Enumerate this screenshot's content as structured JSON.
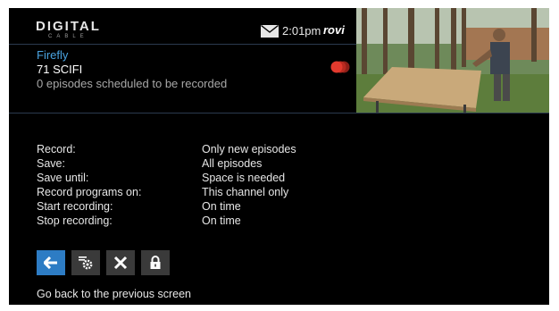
{
  "header": {
    "brand_name": "DIGITAL",
    "brand_sub": "CABLE",
    "time": "2:01pm",
    "provider_logo": "rovi"
  },
  "program": {
    "title": "Firefly",
    "channel": "71 SCIFI",
    "scheduled": "0 episodes scheduled to be recorded"
  },
  "settings": [
    {
      "label": "Record:",
      "value": "Only new episodes"
    },
    {
      "label": "Save:",
      "value": "All episodes"
    },
    {
      "label": "Save until:",
      "value": "Space is needed"
    },
    {
      "label": "Record programs on:",
      "value": "This channel only"
    },
    {
      "label": "Start recording:",
      "value": "On time"
    },
    {
      "label": "Stop recording:",
      "value": "On time"
    }
  ],
  "actions": {
    "icons": [
      "back-arrow-icon",
      "gear-icon",
      "close-icon",
      "lock-icon"
    ]
  },
  "hint": "Go back to the previous screen",
  "colors": {
    "background": "#000000",
    "title": "#4aa3e0",
    "accent_button": "#2d7cc4",
    "button": "#3a3a3a",
    "record_indicator": "#e33a2e"
  }
}
